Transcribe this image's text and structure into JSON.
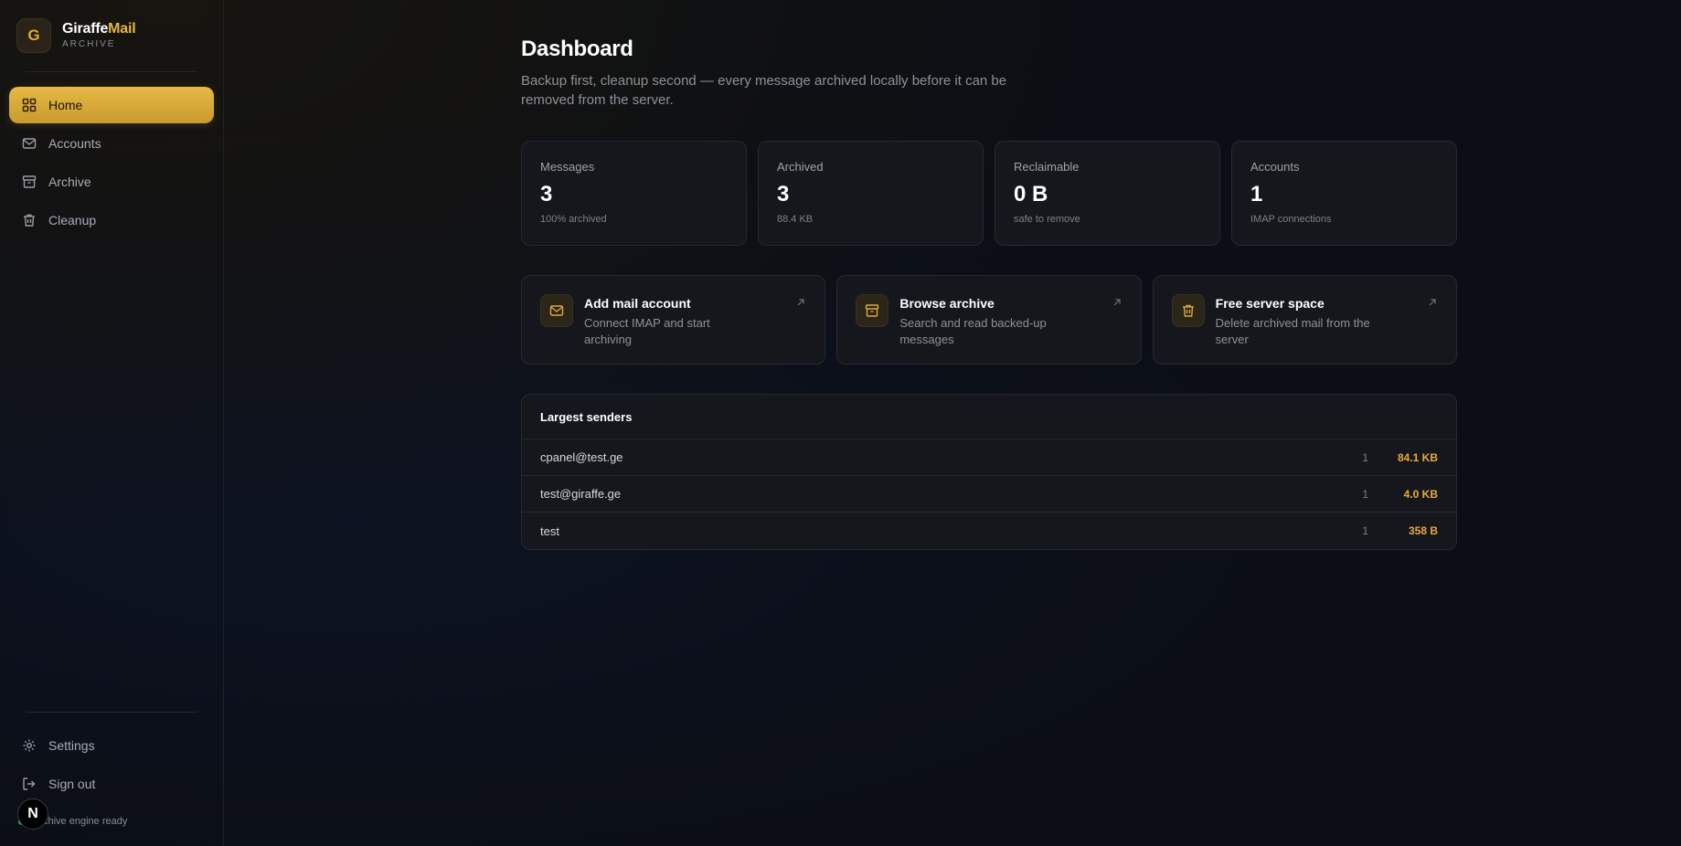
{
  "brand": {
    "logo_letter": "G",
    "name_part1": "Giraffe",
    "name_part2": "Mail",
    "subtitle": "ARCHIVE"
  },
  "sidebar": {
    "items": [
      {
        "label": "Home",
        "icon": "grid-icon",
        "active": true
      },
      {
        "label": "Accounts",
        "icon": "mail-icon"
      },
      {
        "label": "Archive",
        "icon": "archive-box-icon"
      },
      {
        "label": "Cleanup",
        "icon": "trash-icon"
      }
    ],
    "bottom": [
      {
        "label": "Settings",
        "icon": "gear-icon"
      },
      {
        "label": "Sign out",
        "icon": "sign-out-icon"
      }
    ],
    "status": "Archive engine ready",
    "badge": "N"
  },
  "page": {
    "title": "Dashboard",
    "subtitle": "Backup first, cleanup second — every message archived locally before it can be removed from the server."
  },
  "stats": [
    {
      "label": "Messages",
      "value": "3",
      "sub": "100% archived"
    },
    {
      "label": "Archived",
      "value": "3",
      "sub": "88.4 KB"
    },
    {
      "label": "Reclaimable",
      "value": "0 B",
      "sub": "safe to remove"
    },
    {
      "label": "Accounts",
      "value": "1",
      "sub": "IMAP connections"
    }
  ],
  "actions": [
    {
      "title": "Add mail account",
      "desc": "Connect IMAP and start archiving",
      "icon": "mail-icon"
    },
    {
      "title": "Browse archive",
      "desc": "Search and read backed-up messages",
      "icon": "archive-box-icon"
    },
    {
      "title": "Free server space",
      "desc": "Delete archived mail from the server",
      "icon": "trash-icon"
    }
  ],
  "senders": {
    "title": "Largest senders",
    "rows": [
      {
        "name": "cpanel@test.ge",
        "count": "1",
        "size": "84.1 KB"
      },
      {
        "name": "test@giraffe.ge",
        "count": "1",
        "size": "4.0 KB"
      },
      {
        "name": "test",
        "count": "1",
        "size": "358 B"
      }
    ]
  },
  "colors": {
    "accent": "#e8b441",
    "background": "#0b0e15",
    "card": "#15171d",
    "status_ok": "#2bbf6a"
  }
}
